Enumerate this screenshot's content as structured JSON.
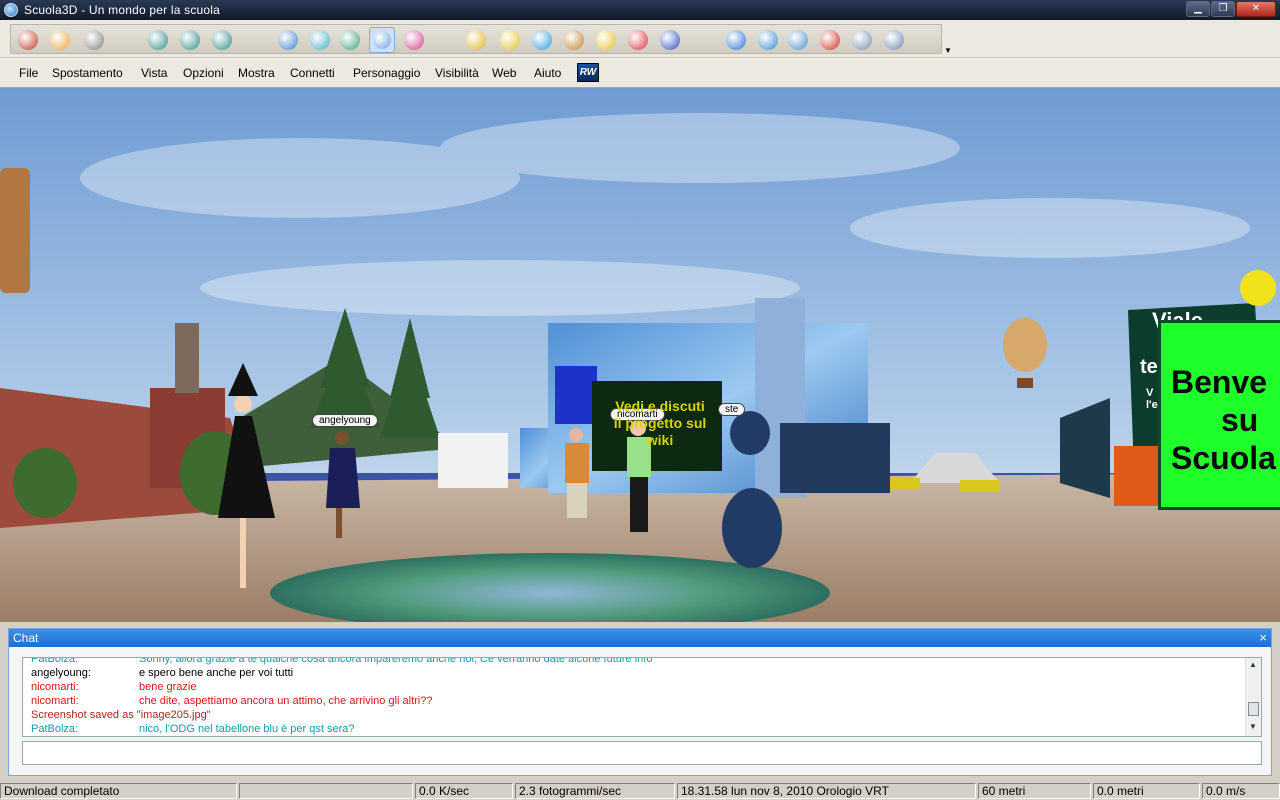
{
  "window": {
    "title": "Scuola3D  -  Un mondo per la scuola",
    "buttons": [
      "minimize",
      "maximize",
      "close"
    ]
  },
  "toolbar": {
    "buttons": [
      {
        "name": "home-icon",
        "color": "#c0392b"
      },
      {
        "name": "back-icon",
        "color": "#e8a33a"
      },
      {
        "name": "forward-icon",
        "color": "#7f7f7f"
      },
      {
        "name": "view-first-person-icon",
        "color": "#2e8b8b"
      },
      {
        "name": "view-third-person-icon",
        "color": "#2e8b8b"
      },
      {
        "name": "view-flying-icon",
        "color": "#2e8b8b"
      },
      {
        "name": "avatar-icon",
        "color": "#3f7fd0"
      },
      {
        "name": "avatar-info-icon",
        "color": "#3fb0c0"
      },
      {
        "name": "avatar-gestures-icon",
        "color": "#3fa080"
      },
      {
        "name": "search-avatar-icon",
        "color": "#6aa0e0"
      },
      {
        "name": "group-icon",
        "color": "#d04090"
      },
      {
        "name": "teleport-icon",
        "color": "#e0b020"
      },
      {
        "name": "edit-icon",
        "color": "#e0c020"
      },
      {
        "name": "chat-bubble-icon",
        "color": "#2a9de0"
      },
      {
        "name": "notes-icon",
        "color": "#c08030"
      },
      {
        "name": "pencil-icon",
        "color": "#e8c020"
      },
      {
        "name": "help-icon",
        "color": "#e03040"
      },
      {
        "name": "settings-icon",
        "color": "#3050c0"
      },
      {
        "name": "browser-icon",
        "color": "#2a70d8"
      },
      {
        "name": "add-icon",
        "color": "#3a8ad0"
      },
      {
        "name": "camera-icon",
        "color": "#4a90c8"
      },
      {
        "name": "stop-icon",
        "color": "#d03020"
      },
      {
        "name": "tools-icon",
        "color": "#7090b0"
      },
      {
        "name": "shirt-icon",
        "color": "#6a8ab0"
      }
    ]
  },
  "menu": {
    "items": [
      "File",
      "Spostamento",
      "Vista",
      "Opzioni",
      "Mostra",
      "Connetti",
      "Personaggio",
      "Visibilità",
      "Web",
      "Aiuto"
    ],
    "logo": "RW"
  },
  "scene": {
    "avatars": [
      "angelyoung",
      "nicomarti",
      "ste"
    ],
    "blue_board": [
      "Vedi e discuti",
      "il progetto sul",
      "wiki"
    ],
    "sign_dark": [
      "Viale",
      "te",
      "V",
      "l'e"
    ],
    "sign_green": [
      "Benve",
      "su",
      "Scuola"
    ]
  },
  "chat": {
    "title": "Chat",
    "close": "×",
    "messages": [
      {
        "name": "PatBolza:",
        "text": "Sonny, allora grazie a te qualche cosa ancora impareremo anche noi, Ce verranno date alcune future info",
        "color": "#1a9aa6"
      },
      {
        "name": "angelyoung:",
        "text": "e spero bene anche per voi tutti",
        "color": "#000000"
      },
      {
        "name": "nicomarti:",
        "text": "bene grazie",
        "color": "#d41818"
      },
      {
        "name": "nicomarti:",
        "text": "che dite, aspettiamo ancora un attimo, che arrivino gli altri??",
        "color": "#d41818"
      },
      {
        "name": "Screenshot saved as \"image205.jpg\"",
        "text": "",
        "color": "#b22222"
      },
      {
        "name": "PatBolza:",
        "text": "nico, l'ODG nel tabellone blu è per qst sera?",
        "color": "#1a9aa6"
      }
    ],
    "input_value": ""
  },
  "status": {
    "download": "Download completato",
    "empty": "",
    "speed": "0.0 K/sec",
    "fps": "2.3 fotogrammi/sec",
    "clock": "18.31.58 lun nov 8, 2010 Orologio VRT",
    "distance": "60 metri",
    "distance2": "0.0 metri",
    "velocity": "0.0 m/s"
  }
}
